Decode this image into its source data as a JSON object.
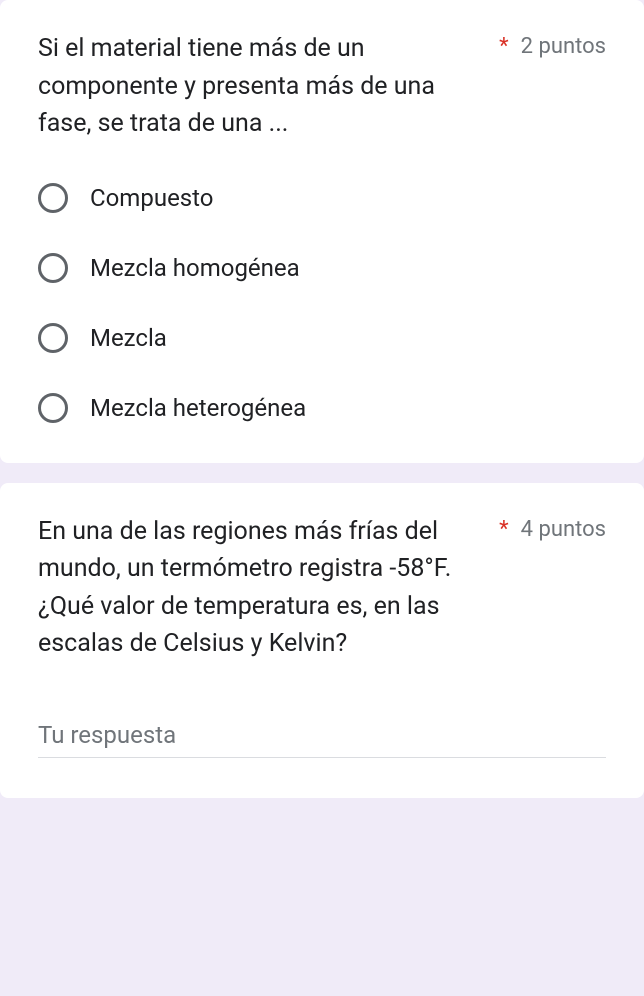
{
  "questions": [
    {
      "text": "Si el material tiene más de un componente y presenta más de una fase, se trata de una ...",
      "required_mark": "*",
      "points": "2 puntos",
      "options": [
        "Compuesto",
        "Mezcla homogénea",
        "Mezcla",
        "Mezcla heterogénea"
      ]
    },
    {
      "text": "En una de las regiones más frías del mundo, un termómetro registra -58°F. ¿Qué valor de temperatura es, en las escalas de Celsius y Kelvin?",
      "required_mark": "*",
      "points": "4 puntos",
      "placeholder": "Tu respuesta"
    }
  ]
}
